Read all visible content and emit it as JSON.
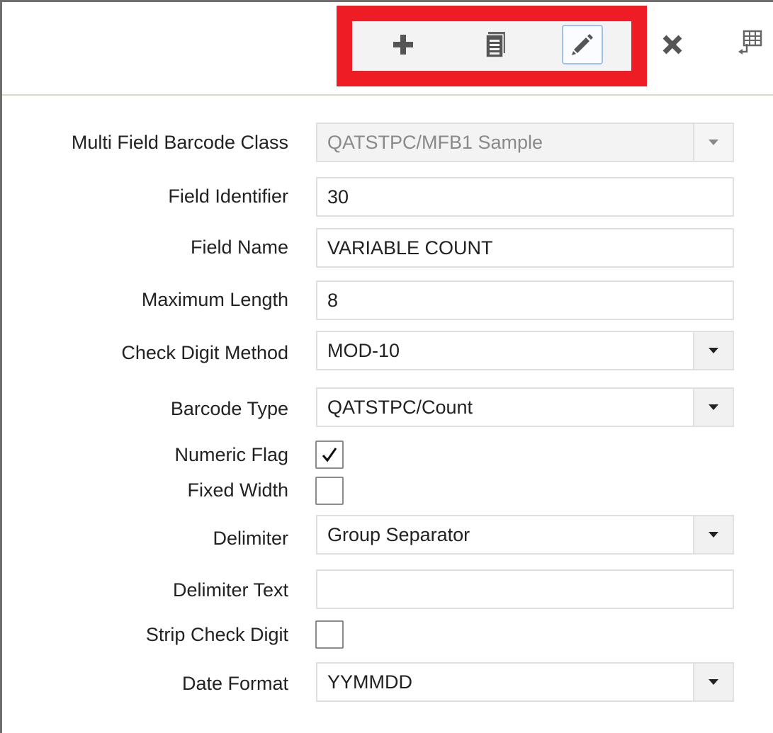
{
  "toolbar": {
    "buttons": [
      {
        "name": "add",
        "icon": "plus-icon"
      },
      {
        "name": "copy",
        "icon": "document-lines-icon"
      },
      {
        "name": "edit",
        "icon": "pencil-icon"
      },
      {
        "name": "close",
        "icon": "close-icon"
      },
      {
        "name": "more",
        "icon": "table-export-icon"
      }
    ],
    "highlight_color": "#ee1c25",
    "icon_color": "#555555"
  },
  "form": {
    "multi_field_barcode_class": {
      "label": "Multi Field Barcode Class",
      "value": "QATSTPC/MFB1 Sample"
    },
    "field_identifier": {
      "label": "Field Identifier",
      "value": "30"
    },
    "field_name": {
      "label": "Field Name",
      "value": "VARIABLE COUNT"
    },
    "maximum_length": {
      "label": "Maximum Length",
      "value": "8"
    },
    "check_digit_method": {
      "label": "Check Digit Method",
      "value": "MOD-10"
    },
    "barcode_type": {
      "label": "Barcode Type",
      "value": "QATSTPC/Count"
    },
    "numeric_flag": {
      "label": "Numeric Flag",
      "checked": true
    },
    "fixed_width": {
      "label": "Fixed Width",
      "checked": false
    },
    "delimiter": {
      "label": "Delimiter",
      "value": "Group Separator"
    },
    "delimiter_text": {
      "label": "Delimiter Text",
      "value": ""
    },
    "strip_check_digit": {
      "label": "Strip Check Digit",
      "checked": false
    },
    "date_format": {
      "label": "Date Format",
      "value": "YYMMDD"
    }
  }
}
